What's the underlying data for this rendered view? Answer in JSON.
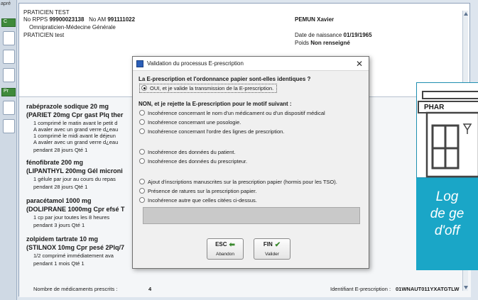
{
  "left_tags": [
    "apré",
    "C",
    "Pr"
  ],
  "header": {
    "practitioner": "PRATICIEN  TEST",
    "rpps_label": "No RPPS",
    "rpps": "99900023138",
    "am_label": "No AM",
    "am": "991111022",
    "specialty": "Omnipraticien-Médecine Générale",
    "practitioner_short": "PRATICIEN test",
    "patient": "PEMUN  Xavier",
    "birth_label": "Date de naissance",
    "birth": "01/19/1965",
    "weight_label": "Poids",
    "weight": "Non renseigné"
  },
  "medications": [
    {
      "title": "rabéprazole sodique 20 mg",
      "sub": "(PARIET 20mg Cpr gast Plq ther",
      "lines": [
        "1 comprimé le matin avant le petit d",
        "A avaler avec un grand verre d¿eau",
        "1 comprimé le midi avant le déjeun",
        "A avaler avec un grand verre d¿eau",
        "pendant 28 jours    Qté 1"
      ]
    },
    {
      "title": "fénofibrate 200 mg",
      "sub": "(LIPANTHYL 200mg Gél microni",
      "lines": [
        "1 gélule par jour au cours du repas",
        "pendant 28 jours    Qté 1"
      ]
    },
    {
      "title": "paracétamol 1000 mg",
      "sub": "(DOLIPRANE 1000mg Cpr efsé T",
      "lines": [
        "1 cp par jour toutes les 8 heures",
        "pendant 3 jours    Qté 1"
      ]
    },
    {
      "title": "zolpidem tartrate 10 mg",
      "sub": "(STILNOX 10mg Cpr pesé 2Plq/7",
      "lines": [
        "1/2 comprimé immédiatement ava",
        "pendant 1 mois    Qté 1"
      ]
    }
  ],
  "footer": {
    "count_label": "Nombre de médicaments prescrits :",
    "count": "4",
    "id_label": "Identifiant E-prescription :",
    "id": "01WNAUT011YXATGTLW"
  },
  "logo": {
    "sign": "PHAR",
    "text_lines": [
      "Log",
      "de ge",
      "d'off"
    ],
    "color_teal": "#1aa6c7"
  },
  "dialog": {
    "title": "Validation du processus E-prescription",
    "question": "La E-prescription et l'ordonnance papier sont-elles identiques ?",
    "yes_option": "OUI, et je valide la transmission de la E-prescription.",
    "no_header": "NON, et je rejette la E-prescription pour le motif suivant :",
    "reasons_group1": [
      "Incohérence concernant le nom d'un médicament ou d'un dispositif médical",
      "Incohérence concernant une posologie.",
      "Incohérence concernant l'ordre des lignes de prescription."
    ],
    "reasons_group2": [
      "Incohérence des données du patient.",
      "Incohérence des données du prescripteur."
    ],
    "reasons_group3": [
      "Ajout d'inscriptions manuscrites sur la prescription papier (hormis pour les TSO).",
      "Présence de ratures sur la prescription papier.",
      "Incohérence autre que celles citées ci-dessus."
    ],
    "esc_key": "ESC",
    "esc_label": "Abandon",
    "fin_key": "FIN",
    "fin_label": "Valider"
  }
}
